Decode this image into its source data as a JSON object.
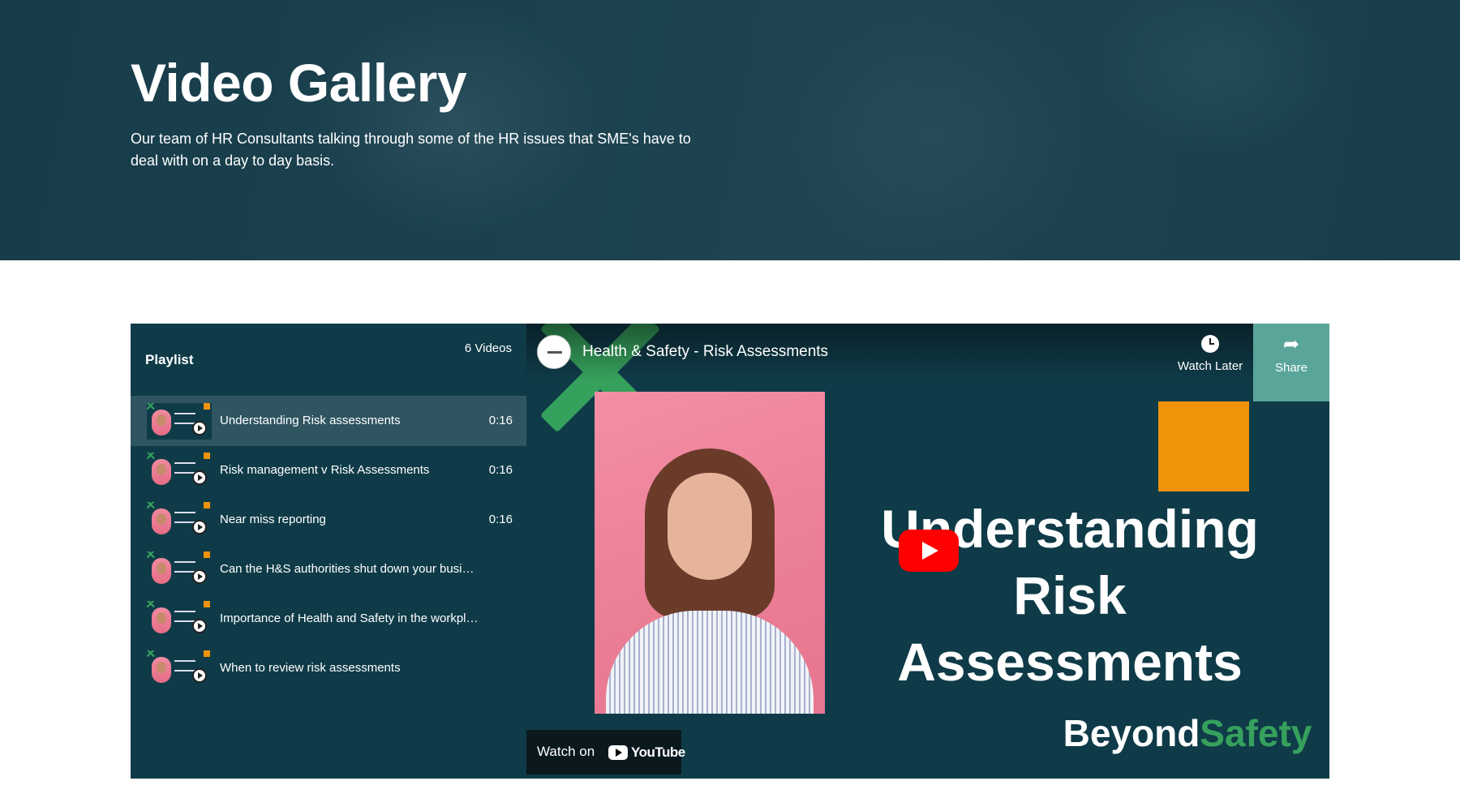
{
  "hero": {
    "title": "Video Gallery",
    "description": "Our team of HR Consultants talking through some of the HR issues that SME's have to deal with on a day to day basis."
  },
  "playlist": {
    "title": "Playlist",
    "count": "6 Videos",
    "items": [
      {
        "label": "Understanding Risk assessments",
        "duration": "0:16"
      },
      {
        "label": "Risk management v Risk Assessments",
        "duration": "0:16"
      },
      {
        "label": "Near miss reporting",
        "duration": "0:16"
      },
      {
        "label": "Can the H&S authorities shut down your business?",
        "duration": ""
      },
      {
        "label": "Importance of Health and Safety in the workplace",
        "duration": ""
      },
      {
        "label": "When to review risk assessments",
        "duration": ""
      }
    ]
  },
  "player": {
    "video_title": "Health & Safety - Risk Assessments",
    "watch_later": "Watch Later",
    "share": "Share",
    "thumb_title": [
      "Understanding",
      "Risk",
      "Assessments"
    ],
    "brand_part1": "Beyond",
    "brand_part2": "Safety",
    "watch_on": "Watch on",
    "youtube": "YouTube"
  },
  "colors": {
    "panel": "#0f3b48",
    "accent_green": "#36a15d",
    "accent_orange": "#f0920a",
    "share_bg": "#5aa59a",
    "youtube_red": "#ff0000"
  }
}
